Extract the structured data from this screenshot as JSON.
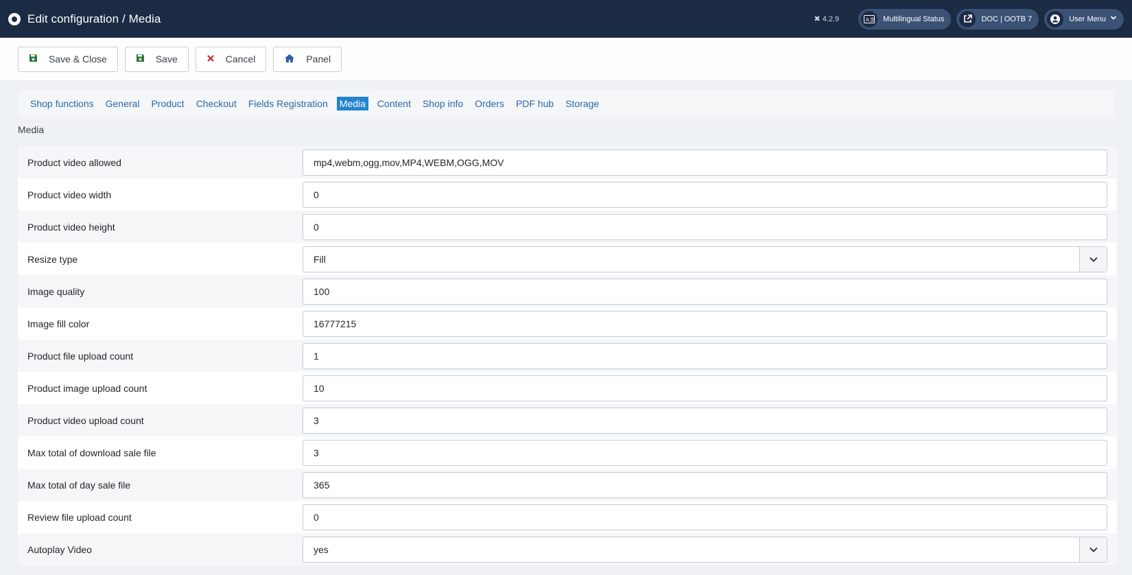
{
  "header": {
    "title": "Edit configuration / Media",
    "version": "4.2.9",
    "pills": [
      {
        "label": "Multilingual Status",
        "icon": "language-icon"
      },
      {
        "label": "DOC | OOTB 7",
        "icon": "external-link-icon"
      },
      {
        "label": "User Menu",
        "icon": "user-icon"
      }
    ]
  },
  "toolbar": {
    "save_close": "Save & Close",
    "save": "Save",
    "cancel": "Cancel",
    "panel": "Panel"
  },
  "tabs": [
    "Shop functions",
    "General",
    "Product",
    "Checkout",
    "Fields Registration",
    "Media",
    "Content",
    "Shop info",
    "Orders",
    "PDF hub",
    "Storage"
  ],
  "active_tab": "Media",
  "section_label": "Media",
  "fields": [
    {
      "label": "Product video allowed",
      "value": "mp4,webm,ogg,mov,MP4,WEBM,OGG,MOV",
      "type": "text"
    },
    {
      "label": "Product video width",
      "value": "0",
      "type": "text"
    },
    {
      "label": "Product video height",
      "value": "0",
      "type": "text"
    },
    {
      "label": "Resize type",
      "value": "Fill",
      "type": "select"
    },
    {
      "label": "Image quality",
      "value": "100",
      "type": "text"
    },
    {
      "label": "Image fill color",
      "value": "16777215",
      "type": "text"
    },
    {
      "label": "Product file upload count",
      "value": "1",
      "type": "text"
    },
    {
      "label": "Product image upload count",
      "value": "10",
      "type": "text"
    },
    {
      "label": "Product video upload count",
      "value": "3",
      "type": "text"
    },
    {
      "label": "Max total of download sale file",
      "value": "3",
      "type": "text"
    },
    {
      "label": "Max total of day sale file",
      "value": "365",
      "type": "text"
    },
    {
      "label": "Review file upload count",
      "value": "0",
      "type": "text"
    },
    {
      "label": "Autoplay Video",
      "value": "yes",
      "type": "select"
    }
  ]
}
